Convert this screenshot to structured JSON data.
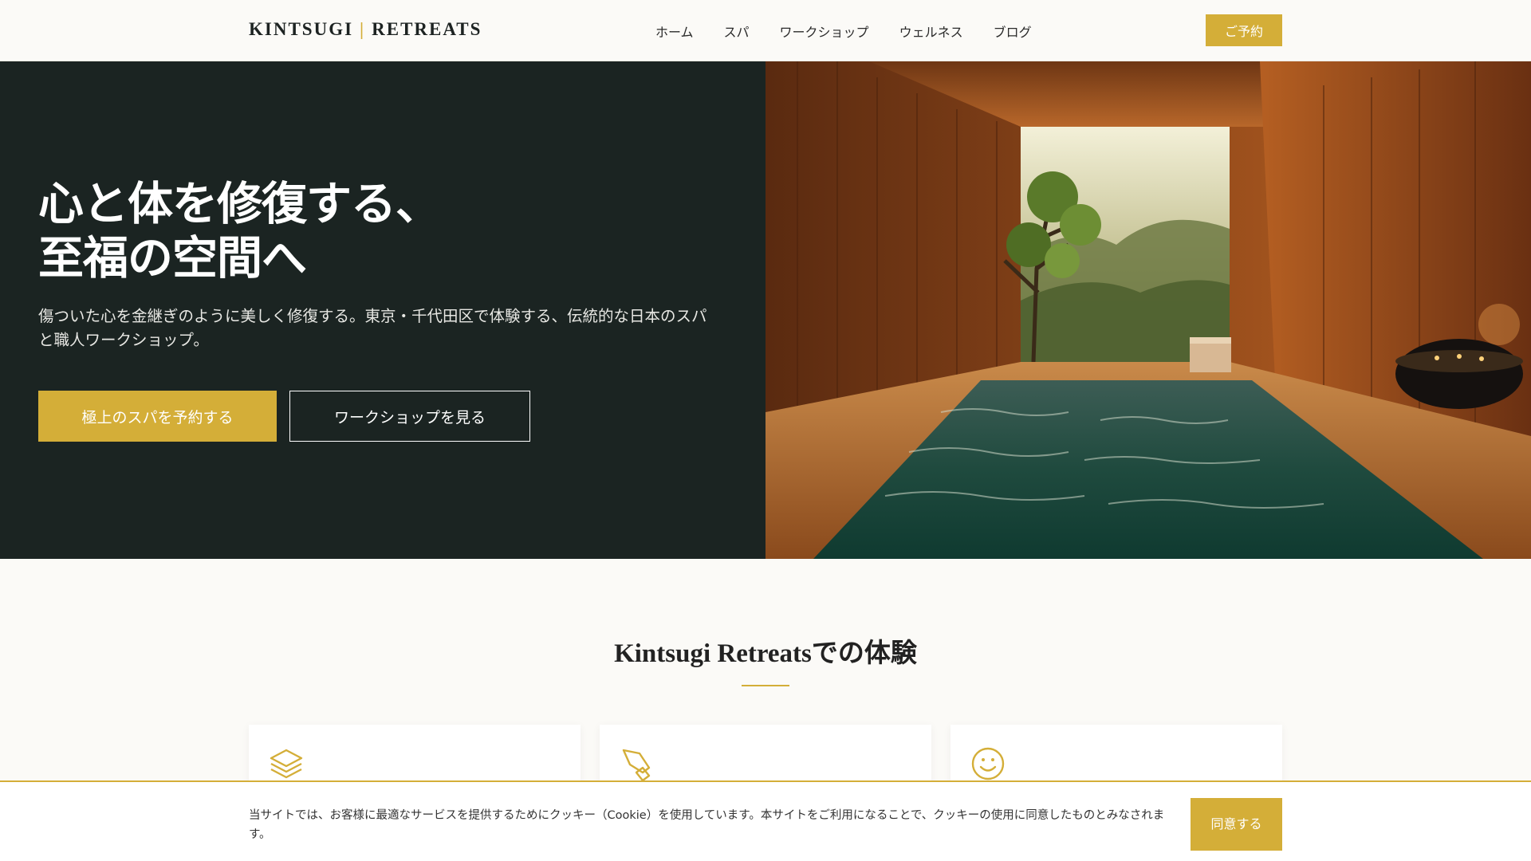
{
  "header": {
    "logo_left": "KINTSUGI",
    "logo_sep": "|",
    "logo_right": "RETREATS",
    "nav": [
      "ホーム",
      "スパ",
      "ワークショップ",
      "ウェルネス",
      "ブログ"
    ],
    "book_label": "ご予約"
  },
  "hero": {
    "title_line1": "心と体を修復する、",
    "title_line2": "至福の空間へ",
    "subtitle": "傷ついた心を金継ぎのように美しく修復する。東京・千代田区で体験する、伝統的な日本のスパと職人ワークショップ。",
    "primary_cta": "極上のスパを予約する",
    "secondary_cta": "ワークショップを見る",
    "image_icon": "spa-bath-photo"
  },
  "experience": {
    "title": "Kintsugi Retreatsでの体験",
    "cards": [
      {
        "icon": "layers-icon"
      },
      {
        "icon": "tag-tools-icon"
      },
      {
        "icon": "smile-icon"
      }
    ]
  },
  "cookie": {
    "text": "当サイトでは、お客様に最適なサービスを提供するためにクッキー（Cookie）を使用しています。本サイトをご利用になることで、クッキーの使用に同意したものとみなされます。",
    "accept": "同意する"
  },
  "colors": {
    "accent": "#d4ae38",
    "hero_bg": "#1b2422",
    "page_bg": "#fbfaf7"
  }
}
